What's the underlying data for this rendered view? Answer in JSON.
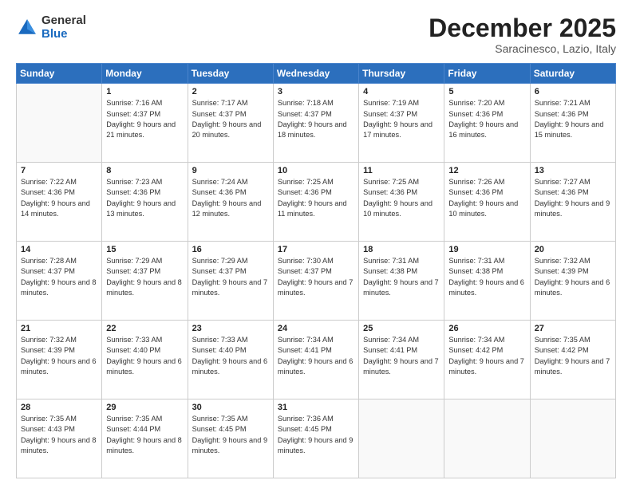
{
  "header": {
    "logo": {
      "general": "General",
      "blue": "Blue"
    },
    "title": "December 2025",
    "location": "Saracinesco, Lazio, Italy"
  },
  "weekdays": [
    "Sunday",
    "Monday",
    "Tuesday",
    "Wednesday",
    "Thursday",
    "Friday",
    "Saturday"
  ],
  "weeks": [
    [
      {
        "day": "",
        "sunrise": "",
        "sunset": "",
        "daylight": ""
      },
      {
        "day": "1",
        "sunrise": "Sunrise: 7:16 AM",
        "sunset": "Sunset: 4:37 PM",
        "daylight": "Daylight: 9 hours and 21 minutes."
      },
      {
        "day": "2",
        "sunrise": "Sunrise: 7:17 AM",
        "sunset": "Sunset: 4:37 PM",
        "daylight": "Daylight: 9 hours and 20 minutes."
      },
      {
        "day": "3",
        "sunrise": "Sunrise: 7:18 AM",
        "sunset": "Sunset: 4:37 PM",
        "daylight": "Daylight: 9 hours and 18 minutes."
      },
      {
        "day": "4",
        "sunrise": "Sunrise: 7:19 AM",
        "sunset": "Sunset: 4:37 PM",
        "daylight": "Daylight: 9 hours and 17 minutes."
      },
      {
        "day": "5",
        "sunrise": "Sunrise: 7:20 AM",
        "sunset": "Sunset: 4:36 PM",
        "daylight": "Daylight: 9 hours and 16 minutes."
      },
      {
        "day": "6",
        "sunrise": "Sunrise: 7:21 AM",
        "sunset": "Sunset: 4:36 PM",
        "daylight": "Daylight: 9 hours and 15 minutes."
      }
    ],
    [
      {
        "day": "7",
        "sunrise": "Sunrise: 7:22 AM",
        "sunset": "Sunset: 4:36 PM",
        "daylight": "Daylight: 9 hours and 14 minutes."
      },
      {
        "day": "8",
        "sunrise": "Sunrise: 7:23 AM",
        "sunset": "Sunset: 4:36 PM",
        "daylight": "Daylight: 9 hours and 13 minutes."
      },
      {
        "day": "9",
        "sunrise": "Sunrise: 7:24 AM",
        "sunset": "Sunset: 4:36 PM",
        "daylight": "Daylight: 9 hours and 12 minutes."
      },
      {
        "day": "10",
        "sunrise": "Sunrise: 7:25 AM",
        "sunset": "Sunset: 4:36 PM",
        "daylight": "Daylight: 9 hours and 11 minutes."
      },
      {
        "day": "11",
        "sunrise": "Sunrise: 7:25 AM",
        "sunset": "Sunset: 4:36 PM",
        "daylight": "Daylight: 9 hours and 10 minutes."
      },
      {
        "day": "12",
        "sunrise": "Sunrise: 7:26 AM",
        "sunset": "Sunset: 4:36 PM",
        "daylight": "Daylight: 9 hours and 10 minutes."
      },
      {
        "day": "13",
        "sunrise": "Sunrise: 7:27 AM",
        "sunset": "Sunset: 4:36 PM",
        "daylight": "Daylight: 9 hours and 9 minutes."
      }
    ],
    [
      {
        "day": "14",
        "sunrise": "Sunrise: 7:28 AM",
        "sunset": "Sunset: 4:37 PM",
        "daylight": "Daylight: 9 hours and 8 minutes."
      },
      {
        "day": "15",
        "sunrise": "Sunrise: 7:29 AM",
        "sunset": "Sunset: 4:37 PM",
        "daylight": "Daylight: 9 hours and 8 minutes."
      },
      {
        "day": "16",
        "sunrise": "Sunrise: 7:29 AM",
        "sunset": "Sunset: 4:37 PM",
        "daylight": "Daylight: 9 hours and 7 minutes."
      },
      {
        "day": "17",
        "sunrise": "Sunrise: 7:30 AM",
        "sunset": "Sunset: 4:37 PM",
        "daylight": "Daylight: 9 hours and 7 minutes."
      },
      {
        "day": "18",
        "sunrise": "Sunrise: 7:31 AM",
        "sunset": "Sunset: 4:38 PM",
        "daylight": "Daylight: 9 hours and 7 minutes."
      },
      {
        "day": "19",
        "sunrise": "Sunrise: 7:31 AM",
        "sunset": "Sunset: 4:38 PM",
        "daylight": "Daylight: 9 hours and 6 minutes."
      },
      {
        "day": "20",
        "sunrise": "Sunrise: 7:32 AM",
        "sunset": "Sunset: 4:39 PM",
        "daylight": "Daylight: 9 hours and 6 minutes."
      }
    ],
    [
      {
        "day": "21",
        "sunrise": "Sunrise: 7:32 AM",
        "sunset": "Sunset: 4:39 PM",
        "daylight": "Daylight: 9 hours and 6 minutes."
      },
      {
        "day": "22",
        "sunrise": "Sunrise: 7:33 AM",
        "sunset": "Sunset: 4:40 PM",
        "daylight": "Daylight: 9 hours and 6 minutes."
      },
      {
        "day": "23",
        "sunrise": "Sunrise: 7:33 AM",
        "sunset": "Sunset: 4:40 PM",
        "daylight": "Daylight: 9 hours and 6 minutes."
      },
      {
        "day": "24",
        "sunrise": "Sunrise: 7:34 AM",
        "sunset": "Sunset: 4:41 PM",
        "daylight": "Daylight: 9 hours and 6 minutes."
      },
      {
        "day": "25",
        "sunrise": "Sunrise: 7:34 AM",
        "sunset": "Sunset: 4:41 PM",
        "daylight": "Daylight: 9 hours and 7 minutes."
      },
      {
        "day": "26",
        "sunrise": "Sunrise: 7:34 AM",
        "sunset": "Sunset: 4:42 PM",
        "daylight": "Daylight: 9 hours and 7 minutes."
      },
      {
        "day": "27",
        "sunrise": "Sunrise: 7:35 AM",
        "sunset": "Sunset: 4:42 PM",
        "daylight": "Daylight: 9 hours and 7 minutes."
      }
    ],
    [
      {
        "day": "28",
        "sunrise": "Sunrise: 7:35 AM",
        "sunset": "Sunset: 4:43 PM",
        "daylight": "Daylight: 9 hours and 8 minutes."
      },
      {
        "day": "29",
        "sunrise": "Sunrise: 7:35 AM",
        "sunset": "Sunset: 4:44 PM",
        "daylight": "Daylight: 9 hours and 8 minutes."
      },
      {
        "day": "30",
        "sunrise": "Sunrise: 7:35 AM",
        "sunset": "Sunset: 4:45 PM",
        "daylight": "Daylight: 9 hours and 9 minutes."
      },
      {
        "day": "31",
        "sunrise": "Sunrise: 7:36 AM",
        "sunset": "Sunset: 4:45 PM",
        "daylight": "Daylight: 9 hours and 9 minutes."
      },
      {
        "day": "",
        "sunrise": "",
        "sunset": "",
        "daylight": ""
      },
      {
        "day": "",
        "sunrise": "",
        "sunset": "",
        "daylight": ""
      },
      {
        "day": "",
        "sunrise": "",
        "sunset": "",
        "daylight": ""
      }
    ]
  ]
}
